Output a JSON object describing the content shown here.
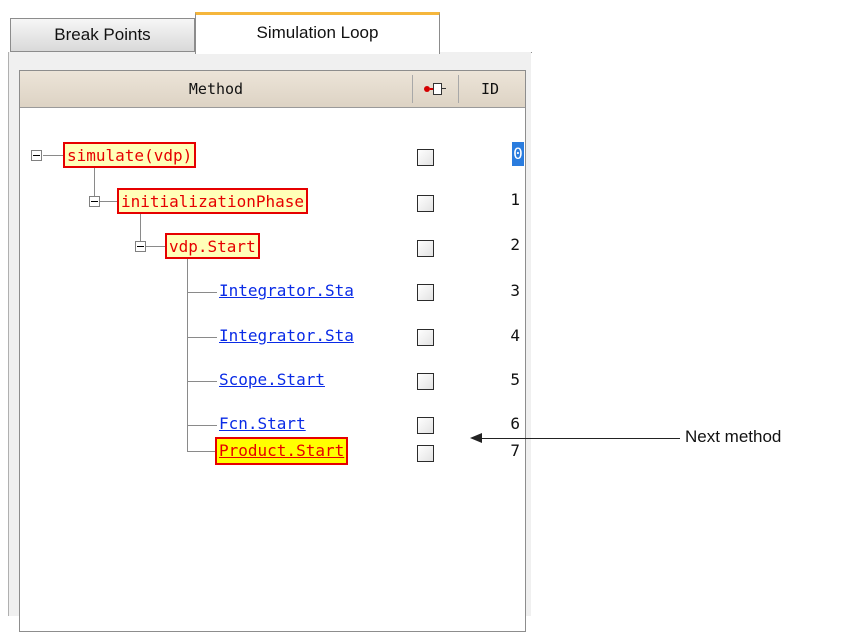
{
  "tabs": [
    {
      "label": "Break Points",
      "active": false
    },
    {
      "label": "Simulation Loop",
      "active": true
    }
  ],
  "table": {
    "columns": {
      "method": "Method",
      "breakpoint_icon": "breakpoint-icon",
      "id": "ID"
    }
  },
  "rows": [
    {
      "method": "simulate(vdp)",
      "id": "0",
      "style": "current-call",
      "expanded": true,
      "selected": true
    },
    {
      "method": "initializationPhase",
      "id": "1",
      "style": "current-call",
      "expanded": true
    },
    {
      "method": "vdp.Start",
      "id": "2",
      "style": "current-call",
      "expanded": true
    },
    {
      "method": "Integrator.Sta",
      "id": "3",
      "style": "link"
    },
    {
      "method": "Integrator.Sta",
      "id": "4",
      "style": "link"
    },
    {
      "method": "Scope.Start",
      "id": "5",
      "style": "link"
    },
    {
      "method": "Fcn.Start",
      "id": "6",
      "style": "link"
    },
    {
      "method": "Product.Start",
      "id": "7",
      "style": "next"
    }
  ],
  "annotation": {
    "text": "Next method"
  },
  "colors": {
    "current_call": "#e60000",
    "highlight_bg": "#ffffb8",
    "next_bg": "#ffff00",
    "link": "#0a2be6",
    "selection": "#2a7cde",
    "tab_accent": "#f5b63c"
  }
}
